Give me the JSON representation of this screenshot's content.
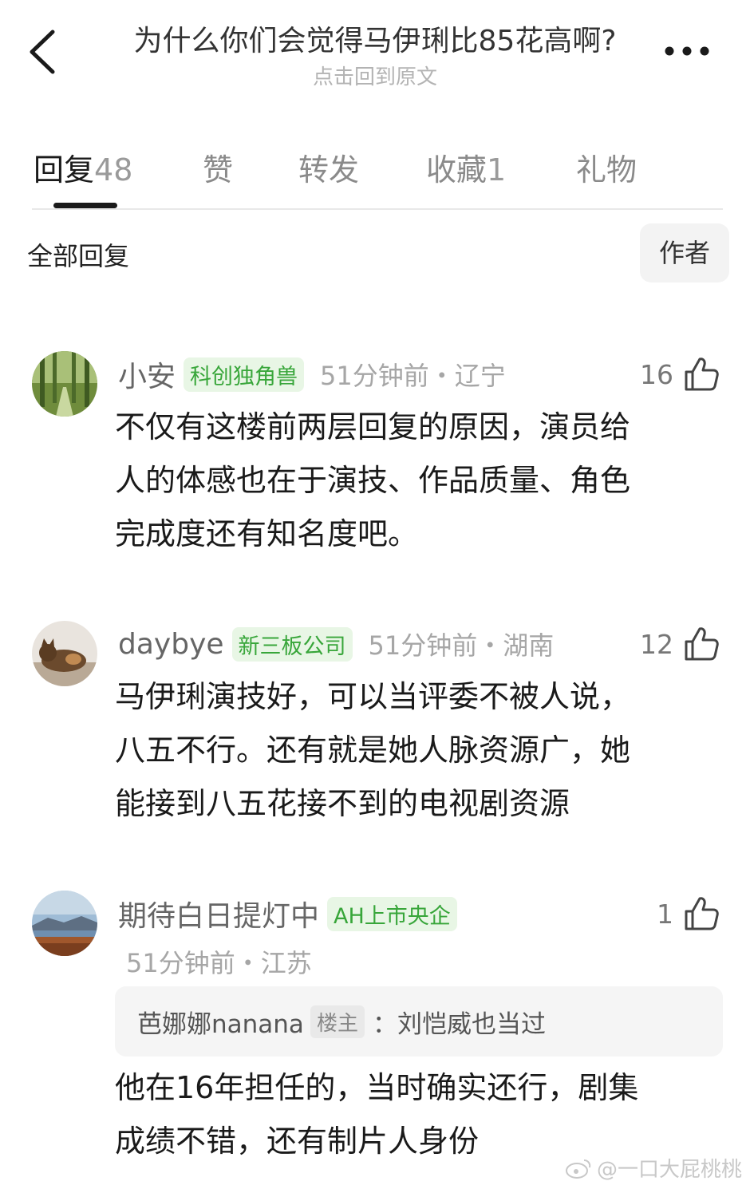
{
  "header": {
    "title": "为什么你们会觉得马伊琍比85花高啊?",
    "subtitle": "点击回到原文"
  },
  "tabs": [
    {
      "label": "回复",
      "count": "48"
    },
    {
      "label": "赞",
      "count": ""
    },
    {
      "label": "转发",
      "count": ""
    },
    {
      "label": "收藏",
      "count": "1"
    },
    {
      "label": "礼物",
      "count": ""
    }
  ],
  "filter": {
    "label": "全部回复",
    "author_button": "作者"
  },
  "comments": [
    {
      "username": "小安",
      "badge": "科创独角兽",
      "time_location": "51分钟前・辽宁",
      "likes": "16",
      "body_lines": [
        "不仅有这楼前两层回复的原因，演员给",
        "人的体感也在于演技、作品质量、角色",
        "完成度还有知名度吧。"
      ]
    },
    {
      "username": "daybye",
      "badge": "新三板公司",
      "time_location": "51分钟前・湖南",
      "likes": "12",
      "body_lines": [
        "马伊琍演技好，可以当评委不被人说，",
        "八五不行。还有就是她人脉资源广，她",
        "能接到八五花接不到的电视剧资源"
      ]
    },
    {
      "username": "期待白日提灯中",
      "badge": "AH上市央企",
      "time_location": "51分钟前・江苏",
      "likes": "1",
      "quote": {
        "user": "芭娜娜nanana",
        "tag": "楼主",
        "text": "：刘恺威也当过"
      },
      "body_lines": [
        "他在16年担任的，当时确实还行，剧集",
        "成绩不错，还有制片人身份"
      ]
    }
  ],
  "watermark": "@一口大屁桃桃",
  "colors": {
    "badge_text": "#38a63a",
    "badge_bg": "#e8f6e5",
    "secondary_text": "#a6a6a6",
    "active_tab": "#1a1a1a"
  }
}
